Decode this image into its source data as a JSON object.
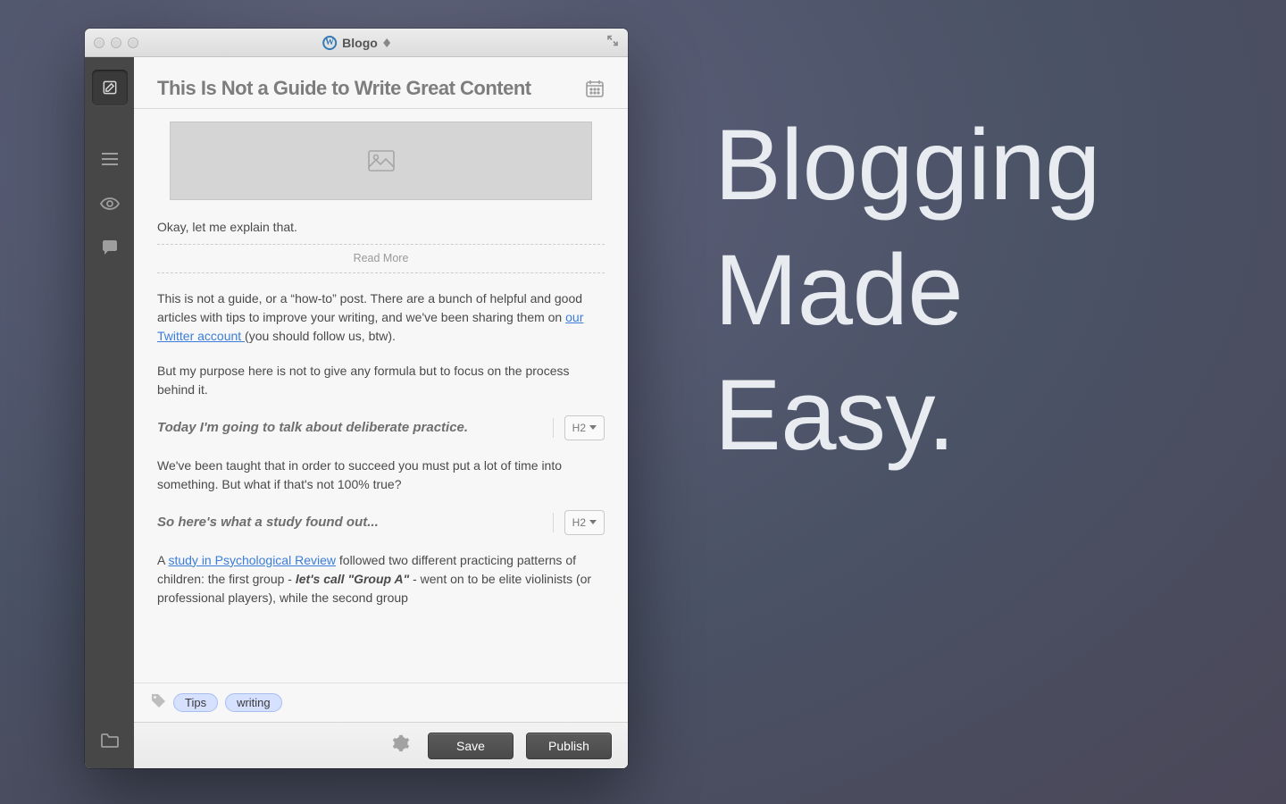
{
  "marketing": {
    "tagline_line1": "Blogging",
    "tagline_line2": "Made",
    "tagline_line3": "Easy."
  },
  "titlebar": {
    "app_name": "Blogo",
    "platform_icon": "wordpress-icon"
  },
  "sidebar": {
    "compose": "compose",
    "icons": [
      "list-icon",
      "eye-icon",
      "comment-icon"
    ],
    "footer_icon": "folder-icon"
  },
  "post": {
    "title": "This Is Not a Guide to Write Great Content",
    "intro": "Okay, let me explain that.",
    "read_more_label": "Read More",
    "para1_part1": "This is not a guide, or a “how-to” post. There are a bunch of helpful and good articles with tips to improve your writing, and we've been sharing them on ",
    "para1_link": "our Twitter account ",
    "para1_part2": "(you should follow us, btw).",
    "para2": "But my purpose here is not to give any formula but to focus on the process behind it.",
    "heading1": "Today I'm going to talk about deliberate practice.",
    "heading1_level": "H2",
    "para3": "We've been taught that in order to succeed you must put a lot of time into something. But what if that's not 100% true?",
    "heading2": "So here's what a study found out...",
    "heading2_level": "H2",
    "para4_pre": "A ",
    "para4_link": "study in Psychological Review",
    "para4_mid": " followed two different practicing patterns of children: the first group - ",
    "para4_bold": "let's call \"Group A\"",
    "para4_post": " - went on to be elite violinists (or professional players), while the second group"
  },
  "tags": [
    "Tips",
    "writing"
  ],
  "footer": {
    "save_label": "Save",
    "publish_label": "Publish"
  }
}
